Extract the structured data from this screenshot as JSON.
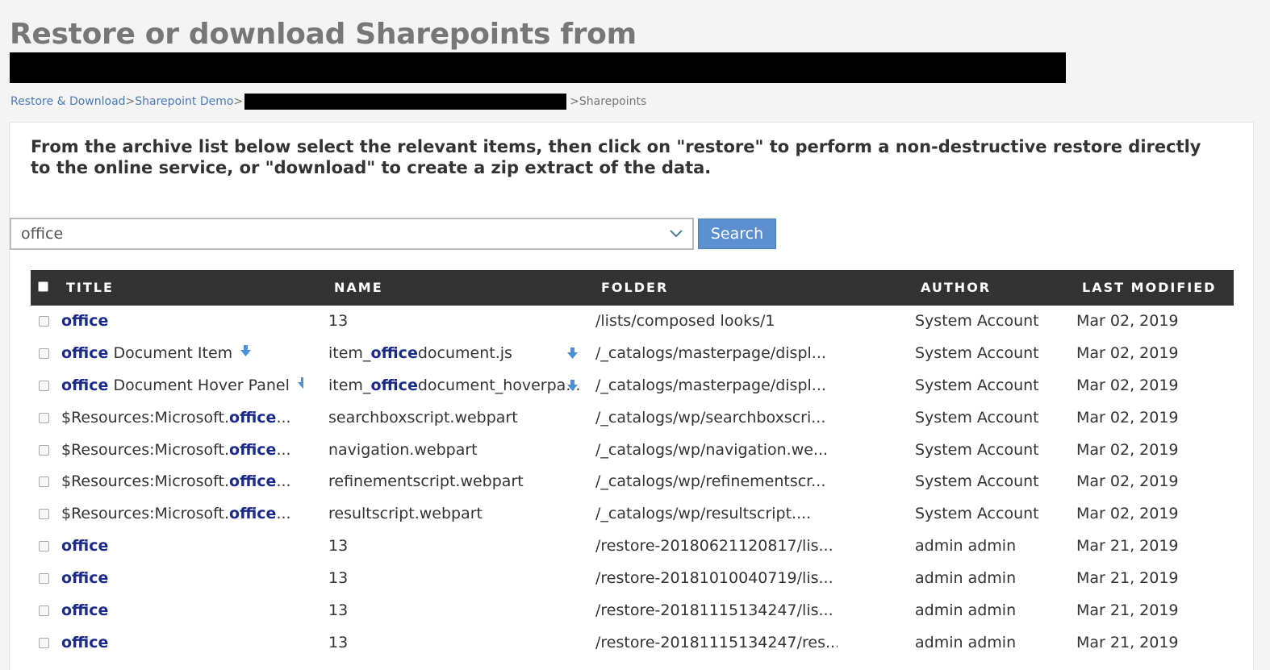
{
  "page": {
    "title": "Restore or download Sharepoints from"
  },
  "breadcrumb": {
    "items": [
      {
        "label": "Restore & Download"
      },
      {
        "label": "Sharepoint Demo"
      }
    ],
    "separator": ">",
    "current": "Sharepoints"
  },
  "instructions": "From the archive list below select the relevant items, then click on \"restore\" to perform a non-destructive restore directly to the online service, or \"download\" to create a zip extract of the data.",
  "search": {
    "value": "office",
    "button_label": "Search"
  },
  "table": {
    "columns": [
      "TITLE",
      "NAME",
      "FOLDER",
      "AUTHOR",
      "LAST MODIFIED"
    ],
    "rows": [
      {
        "title_pre": "",
        "title_hl": "office",
        "title_post": "",
        "title_dl": false,
        "name_pre": "13",
        "name_hl": "",
        "name_post": "",
        "name_dl": false,
        "folder": "/lists/composed looks/1",
        "author": "System Account",
        "modified": "Mar 02, 2019"
      },
      {
        "title_pre": "",
        "title_hl": "office",
        "title_post": " Document Item",
        "title_dl": true,
        "name_pre": "item_",
        "name_hl": "office",
        "name_post": "document.js",
        "name_dl": true,
        "folder": "/_catalogs/masterpage/displ...",
        "author": "System Account",
        "modified": "Mar 02, 2019"
      },
      {
        "title_pre": "",
        "title_hl": "office",
        "title_post": " Document Hover Panel",
        "title_dl": true,
        "name_pre": "item_",
        "name_hl": "office",
        "name_post": "document_hoverpa...",
        "name_dl": true,
        "folder": "/_catalogs/masterpage/displ...",
        "author": "System Account",
        "modified": "Mar 02, 2019"
      },
      {
        "title_pre": "$Resources:Microsoft.",
        "title_hl": "office",
        "title_post": "...",
        "title_dl": false,
        "name_pre": "searchboxscript.webpart",
        "name_hl": "",
        "name_post": "",
        "name_dl": false,
        "folder": "/_catalogs/wp/searchboxscri...",
        "author": "System Account",
        "modified": "Mar 02, 2019"
      },
      {
        "title_pre": "$Resources:Microsoft.",
        "title_hl": "office",
        "title_post": "...",
        "title_dl": false,
        "name_pre": "navigation.webpart",
        "name_hl": "",
        "name_post": "",
        "name_dl": false,
        "folder": "/_catalogs/wp/navigation.we...",
        "author": "System Account",
        "modified": "Mar 02, 2019"
      },
      {
        "title_pre": "$Resources:Microsoft.",
        "title_hl": "office",
        "title_post": "...",
        "title_dl": false,
        "name_pre": "refinementscript.webpart",
        "name_hl": "",
        "name_post": "",
        "name_dl": false,
        "folder": "/_catalogs/wp/refinementscr...",
        "author": "System Account",
        "modified": "Mar 02, 2019"
      },
      {
        "title_pre": "$Resources:Microsoft.",
        "title_hl": "office",
        "title_post": "...",
        "title_dl": false,
        "name_pre": "resultscript.webpart",
        "name_hl": "",
        "name_post": "",
        "name_dl": false,
        "folder": "/_catalogs/wp/resultscript....",
        "author": "System Account",
        "modified": "Mar 02, 2019"
      },
      {
        "title_pre": "",
        "title_hl": "office",
        "title_post": "",
        "title_dl": false,
        "name_pre": "13",
        "name_hl": "",
        "name_post": "",
        "name_dl": false,
        "folder": "/restore-20180621120817/lis...",
        "author": "admin admin",
        "modified": "Mar 21, 2019"
      },
      {
        "title_pre": "",
        "title_hl": "office",
        "title_post": "",
        "title_dl": false,
        "name_pre": "13",
        "name_hl": "",
        "name_post": "",
        "name_dl": false,
        "folder": "/restore-20181010040719/lis...",
        "author": "admin admin",
        "modified": "Mar 21, 2019"
      },
      {
        "title_pre": "",
        "title_hl": "office",
        "title_post": "",
        "title_dl": false,
        "name_pre": "13",
        "name_hl": "",
        "name_post": "",
        "name_dl": false,
        "folder": "/restore-20181115134247/lis...",
        "author": "admin admin",
        "modified": "Mar 21, 2019"
      },
      {
        "title_pre": "",
        "title_hl": "office",
        "title_post": "",
        "title_dl": false,
        "name_pre": "13",
        "name_hl": "",
        "name_post": "",
        "name_dl": false,
        "folder": "/restore-20181115134247/res...",
        "author": "admin admin",
        "modified": "Mar 21, 2019"
      }
    ]
  },
  "colors": {
    "link": "#4a7bb7",
    "highlight": "#1a2a8a",
    "header_bg": "#333333",
    "button_bg": "#5b8fd0",
    "download_icon": "#4a90d9"
  },
  "icons": {
    "combo_toggle": "chevron-down-icon",
    "row_download": "download-arrow-icon"
  }
}
